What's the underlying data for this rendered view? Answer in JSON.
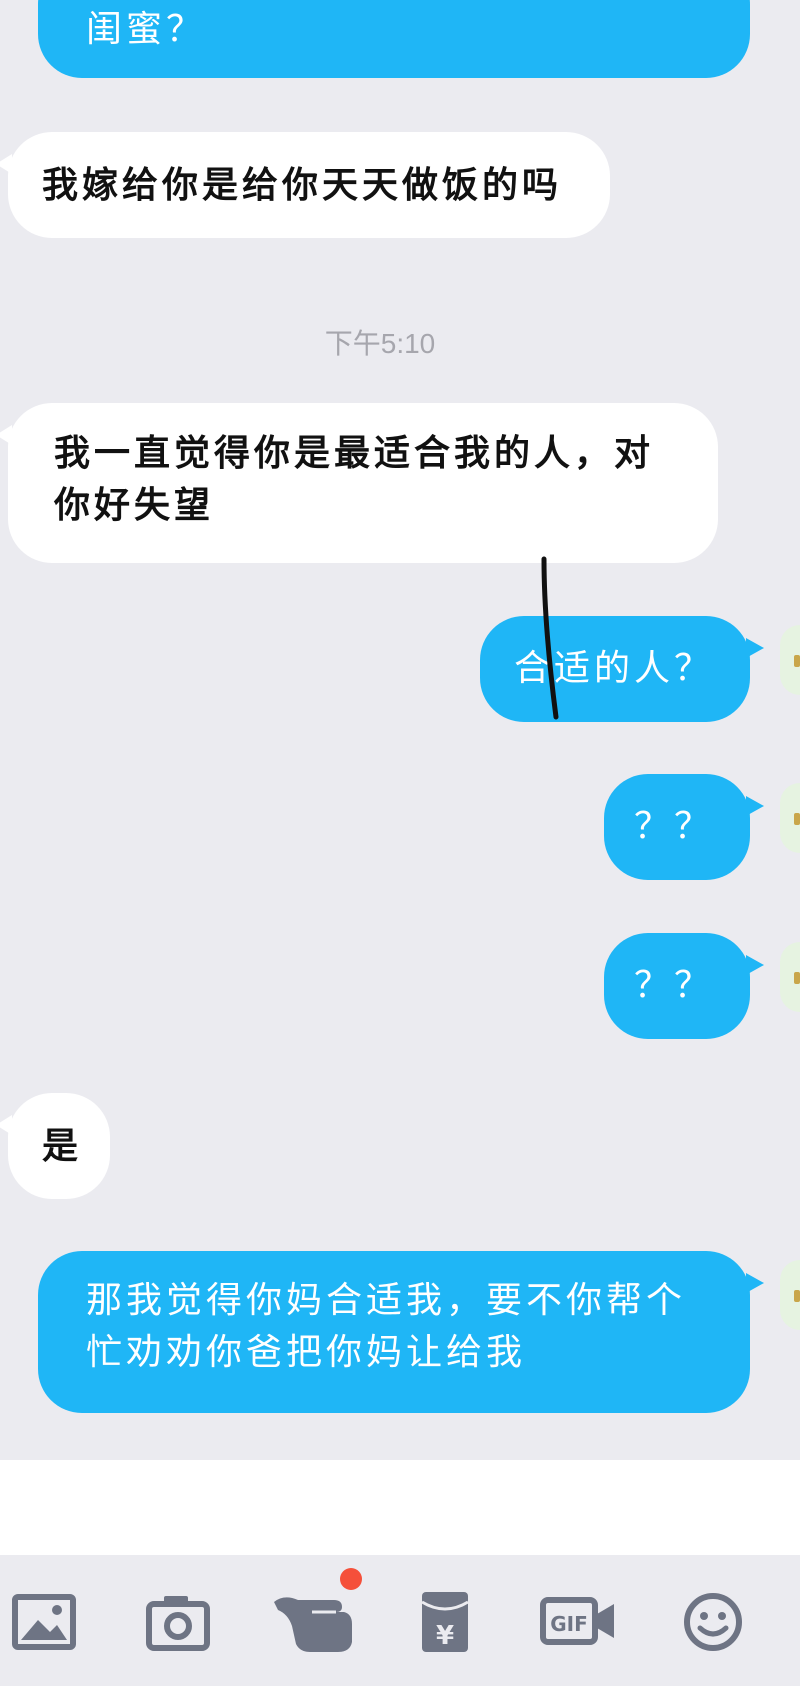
{
  "messages": [
    {
      "side": "sent",
      "text": "闺蜜？"
    },
    {
      "side": "received",
      "text": "我嫁给你是给你天天做饭的吗"
    },
    {
      "type": "timestamp",
      "text": "下午5:10"
    },
    {
      "side": "received",
      "text": "我一直觉得你是最适合我的人，对你好失望"
    },
    {
      "side": "sent",
      "text": "合适的人？"
    },
    {
      "side": "sent",
      "text": "？？"
    },
    {
      "side": "sent",
      "text": "？？"
    },
    {
      "side": "received",
      "text": "是"
    },
    {
      "side": "sent",
      "text": "那我觉得你妈合适我，要不你帮个忙劝劝你爸把你妈让给我"
    }
  ],
  "toolbar": {
    "icons": [
      "image-icon",
      "camera-icon",
      "poke-hand-icon",
      "red-packet-icon",
      "gif-icon",
      "emoji-icon"
    ],
    "red_packet_symbol": "¥",
    "gif_label": "GIF",
    "badge_color": "#f5503a"
  },
  "colors": {
    "sent_bubble": "#1fb6f6",
    "received_bubble": "#ffffff",
    "background": "#ebebf0"
  }
}
